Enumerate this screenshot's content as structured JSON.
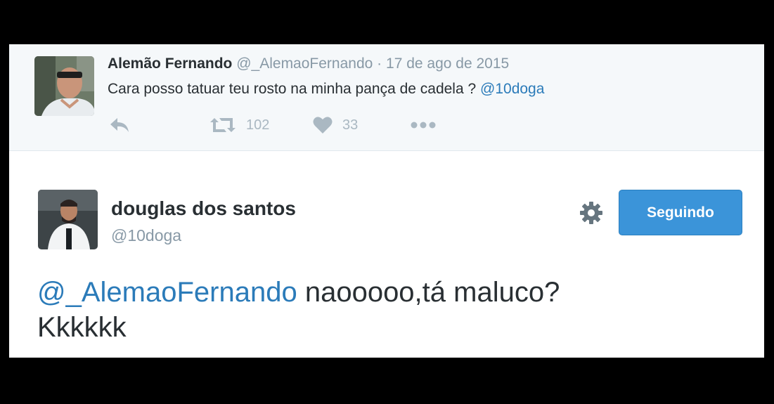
{
  "parent_tweet": {
    "author_name": "Alemão Fernando",
    "author_handle": "@_AlemaoFernando",
    "separator": "·",
    "date": "17 de ago de 2015",
    "text": "Cara posso tatuar teu rosto na minha pança de cadela ? ",
    "mention": "@10doga",
    "actions": {
      "reply_icon": "reply-icon",
      "retweet_icon": "retweet-icon",
      "retweet_count": "102",
      "like_icon": "heart-icon",
      "like_count": "33",
      "more_icon": "more-dots-icon"
    }
  },
  "main_tweet": {
    "author_name": "douglas dos santos",
    "author_handle": "@10doga",
    "settings_icon": "gear-icon",
    "follow_button_label": "Seguindo",
    "mention": "@_AlemaoFernando",
    "text_line1": " naooooo,tá maluco?",
    "text_line2": "Kkkkkk"
  },
  "colors": {
    "link": "#2b7bb9",
    "button": "#3b94d9",
    "muted": "#8899a6",
    "action_icons": "#aab8c2",
    "text": "#292f33"
  }
}
